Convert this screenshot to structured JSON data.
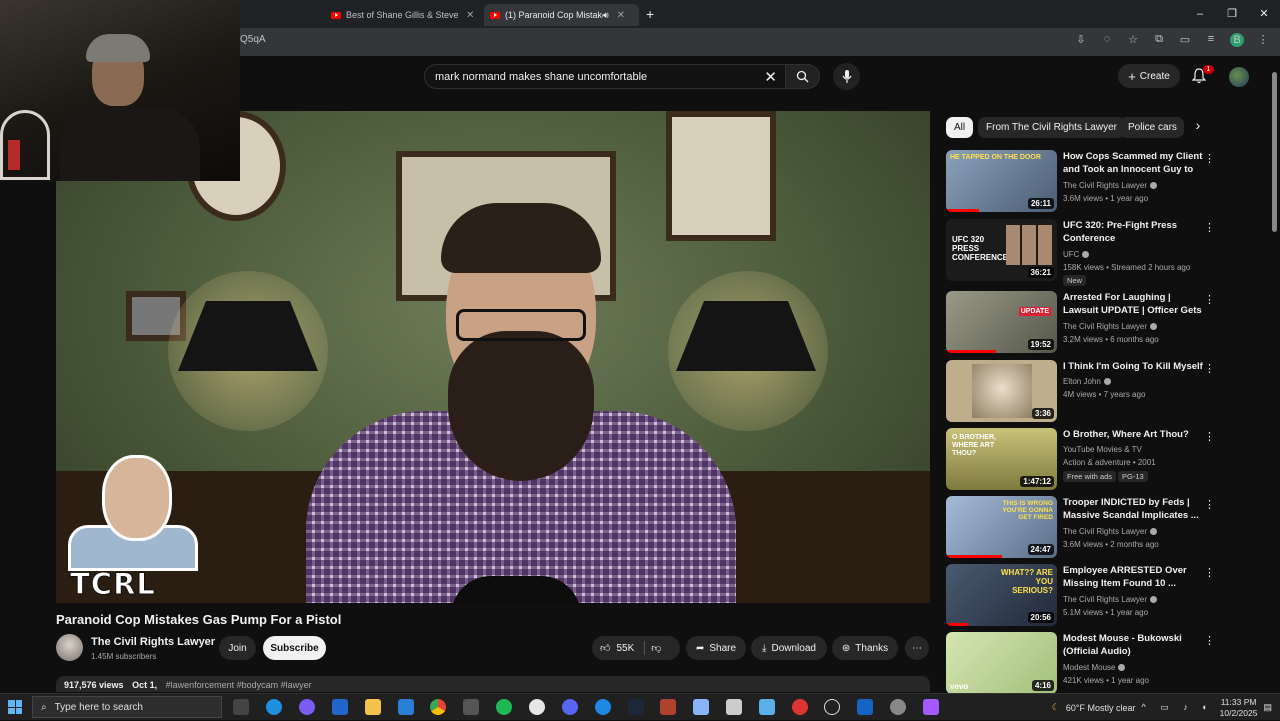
{
  "browser": {
    "tabs": [
      {
        "label": "Best of Shane Gillis & Steve Ge",
        "active": false
      },
      {
        "label": "(1) Paranoid Cop Mistakes",
        "active": true
      }
    ],
    "url_fragment": "Q5qA",
    "window_controls": [
      "–",
      "❐",
      "✕"
    ],
    "profile_letter": "B"
  },
  "youtube": {
    "search": {
      "query": "mark normand makes shane uncomfortable"
    },
    "create_label": "Create",
    "notification_count": "1"
  },
  "video": {
    "title": "Paranoid Cop Mistakes Gas Pump For a Pistol",
    "overlay_text": "TCRL",
    "channel": {
      "name": "The Civil Rights Lawyer",
      "subscribers": "1.45M subscribers"
    },
    "join_label": "Join",
    "subscribe_label": "Subscribe",
    "likes": "55K",
    "share_label": "Share",
    "download_label": "Download",
    "thanks_label": "Thanks",
    "views": "917,576 views",
    "date": "Oct 1,",
    "tags": "#lawenforcement #bodycam #lawyer"
  },
  "chips": [
    "All",
    "From The Civil Rights Lawyer",
    "Police cars"
  ],
  "recommendations": [
    {
      "title": "How Cops Scammed my Client and Took an Innocent Guy to ...",
      "channel": "The Civil Rights Lawyer",
      "meta": "3.6M views • 1 year ago",
      "duration": "26:11",
      "thumb_text": "HE TAPPED ON THE DOOR",
      "color": "#7d8fa8",
      "progress": 0.3
    },
    {
      "title": "UFC 320: Pre-Fight Press Conference",
      "channel": "UFC",
      "meta": "158K views • Streamed 2 hours ago",
      "duration": "36:21",
      "badge": "New",
      "thumb_text": "UFC 320 PRESS CONFERENCE",
      "color": "#1b1b1b",
      "progress": 0
    },
    {
      "title": "Arrested For Laughing | Lawsuit UPDATE | Officer Gets Qualifie...",
      "channel": "The Civil Rights Lawyer",
      "meta": "3.2M views • 6 months ago",
      "duration": "19:52",
      "thumb_text": "UPDATE",
      "color": "#7f7f6e",
      "progress": 0.45
    },
    {
      "title": "I Think I'm Going To Kill Myself",
      "channel": "Elton John",
      "meta": "4M views • 7 years ago",
      "duration": "3:36",
      "thumb_text": "",
      "color": "#cdbb96",
      "progress": 0
    },
    {
      "title": "O Brother, Where Art Thou?",
      "channel": "YouTube Movies & TV",
      "meta": "Action & adventure • 2001",
      "duration": "1:47:12",
      "badge": "Free with ads",
      "badge2": "PG-13",
      "thumb_text": "O BROTHER, WHERE ART THOU?",
      "color": "#a59c58",
      "progress": 0
    },
    {
      "title": "Trooper INDICTED by Feds | Massive Scandal Implicates ...",
      "channel": "The Civil Rights Lawyer",
      "meta": "3.6M views • 2 months ago",
      "duration": "24:47",
      "thumb_text": "THIS IS WRONG YOU'RE GONNA GET FIRED",
      "color": "#7f98b8",
      "progress": 0.5
    },
    {
      "title": "Employee ARRESTED Over Missing Item Found 10 ...",
      "channel": "The Civil Rights Lawyer",
      "meta": "5.1M views • 1 year ago",
      "duration": "20:56",
      "thumb_text": "WHAT?? ARE YOU SERIOUS?",
      "color": "#3d4a5c",
      "progress": 0.2
    },
    {
      "title": "Modest Mouse - Bukowski (Official Audio)",
      "channel": "Modest Mouse",
      "meta": "421K views • 1 year ago",
      "duration": "4:16",
      "thumb_text": "vevo",
      "color": "#c7dca0",
      "progress": 0
    }
  ],
  "taskbar": {
    "search_placeholder": "Type here to search",
    "weather": "60°F  Mostly clear",
    "time": "11:33 PM",
    "date": "10/2/2025"
  },
  "colors": {
    "accent": "#ff0000",
    "bg": "#0f0f0f",
    "chip_bg": "#272727"
  }
}
